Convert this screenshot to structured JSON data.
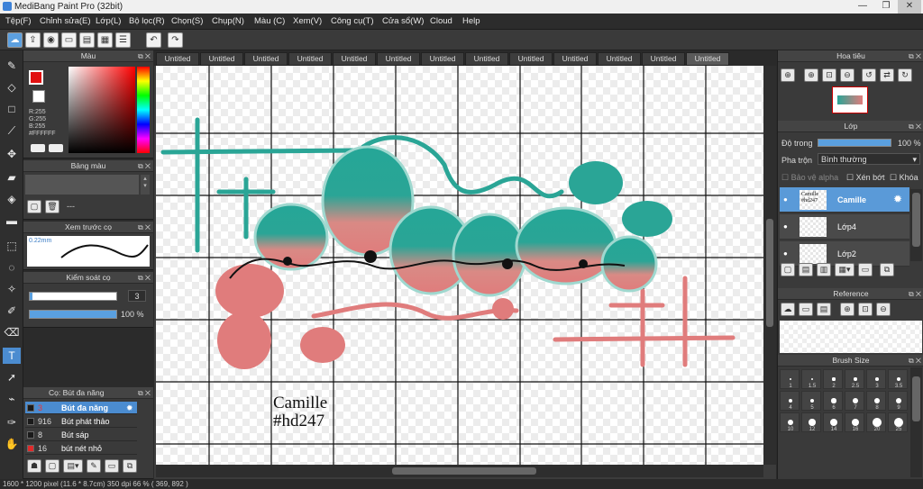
{
  "app": {
    "title": "MediBang Paint Pro (32bit)",
    "win_min": "—",
    "win_max": "❐",
    "win_close": "✕"
  },
  "menu": [
    "Tệp(F)",
    "Chỉnh sửa(E)",
    "Lớp(L)",
    "Bộ lọc(R)",
    "Chọn(S)",
    "Chụp(N)",
    "Màu (C)",
    "Xem(V)",
    "Công cụ(T)",
    "Cửa sổ(W)",
    "Cloud",
    "Help"
  ],
  "panels": {
    "color": {
      "title": "Màu",
      "r": "R:255",
      "g": "G:255",
      "b": "B:255",
      "hex": "#FFFFFF",
      "fg": "#e11010",
      "bg": "#ffffff"
    },
    "palette": {
      "title": "Bảng màu",
      "dash": "---"
    },
    "preview": {
      "title": "Xem trước cọ",
      "size": "0.22mm"
    },
    "brush_ctrl": {
      "title": "Kiểm soát cọ",
      "size": "3",
      "opacity": "100 %",
      "opacity_value": 100
    },
    "brush_list": {
      "title": "Cọ: Bút đa năng",
      "items": [
        {
          "size": "3",
          "name": "Bút đa năng",
          "selected": true,
          "color": "#1a1a1a"
        },
        {
          "size": "916",
          "name": "Bút phát thảo",
          "selected": false,
          "color": "#1a1a1a"
        },
        {
          "size": "8",
          "name": "Bút sáp",
          "selected": false,
          "color": "#1a1a1a"
        },
        {
          "size": "16",
          "name": "bút nét nhỏ",
          "selected": false,
          "color": "#e02a2a"
        }
      ]
    }
  },
  "tabs": [
    "Untitled",
    "Untitled",
    "Untitled",
    "Untitled",
    "Untitled",
    "Untitled",
    "Untitled",
    "Untitled",
    "Untitled",
    "Untitled",
    "Untitled",
    "Untitled",
    "Untitled"
  ],
  "canvas": {
    "text_line1": "Camille",
    "text_line2": "#hd247"
  },
  "right": {
    "navigator": {
      "title": "Hoa tiêu"
    },
    "layer": {
      "title": "Lớp",
      "opacity_label": "Độ trong",
      "opacity": "100 %",
      "blend_label": "Pha trộn",
      "blend": "Bình thường",
      "protect_alpha": "Bảo vệ alpha",
      "clipping": "Xén bớt",
      "lock": "Khóa",
      "layers": [
        {
          "name": "Camille",
          "thumb": "Camille #hd247",
          "selected": true
        },
        {
          "name": "Lớp4",
          "thumb": "",
          "selected": false
        },
        {
          "name": "Lớp2",
          "thumb": "",
          "selected": false
        }
      ]
    },
    "reference": {
      "title": "Reference"
    },
    "brush_size": {
      "title": "Brush Size",
      "labels": [
        "1",
        "1.5",
        "2",
        "2.5",
        "3",
        "3.5",
        "4",
        "5",
        "6",
        "7",
        "8",
        "9",
        "10",
        "12",
        "14",
        "16",
        "20",
        "25"
      ]
    }
  },
  "status": "1600 * 1200 pixel   (11.6 * 8.7cm)  350 dpi  66 %   ( 369, 892 )",
  "colors": {
    "teal": "#2aa596",
    "pink": "#e07c7c",
    "accent": "#4b8cd0"
  }
}
